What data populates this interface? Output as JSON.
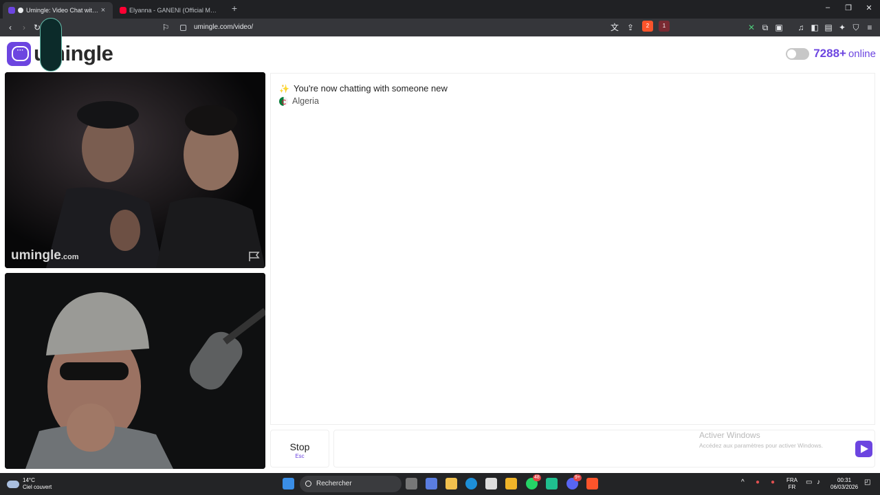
{
  "browser": {
    "tabs": [
      {
        "title": "Umingle: Video Chat with Str",
        "active": true
      },
      {
        "title": "Elyanna - GANENI (Official Music Vid",
        "active": false
      }
    ],
    "url": "umingle.com/video/",
    "shield_badge": "2",
    "alert_badge": "1"
  },
  "header": {
    "brand": "umingle",
    "online_count": "7288+",
    "online_label": "online"
  },
  "remote_video": {
    "watermark_main": "umingle",
    "watermark_tld": ".com"
  },
  "chat": {
    "status_line": "You're now chatting with someone new",
    "country": "Algeria"
  },
  "controls": {
    "stop_label": "Stop",
    "stop_key": "Esc",
    "message_placeholder": ""
  },
  "windows_activation": {
    "title": "Activer Windows",
    "subtitle": "Accédez aux paramètres pour activer Windows."
  },
  "taskbar": {
    "weather_temp": "14°C",
    "weather_desc": "Ciel couvert",
    "search_label": "Rechercher",
    "whatsapp_badge": "48",
    "discord_badge": "9+",
    "lang_top": "FRA",
    "lang_bottom": "FR",
    "time": "00:31",
    "date": "06/03/2026"
  },
  "colors": {
    "accent": "#6c45e0",
    "chrome_dark": "#202124",
    "taskbar": "#232426"
  }
}
